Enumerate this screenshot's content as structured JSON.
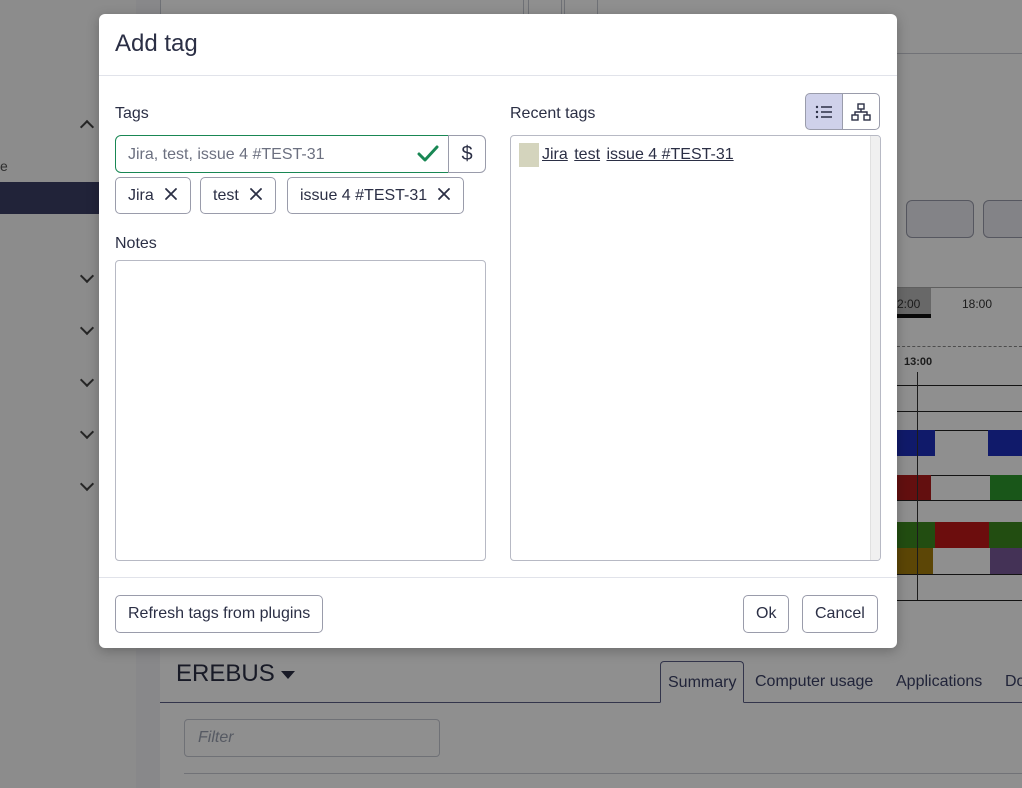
{
  "dialog": {
    "title": "Add tag",
    "tags_label": "Tags",
    "tags_input_value": "Jira, test, issue 4 #TEST-31",
    "billable_symbol": "$",
    "chips": [
      {
        "label": "Jira"
      },
      {
        "label": "test"
      },
      {
        "label": "issue 4 #TEST-31"
      }
    ],
    "notes_label": "Notes",
    "notes_value": "",
    "recent_label": "Recent tags",
    "recent_tags": [
      "Jira",
      "test",
      "issue 4 #TEST-31"
    ],
    "footer": {
      "refresh_label": "Refresh tags from plugins",
      "ok_label": "Ok",
      "cancel_label": "Cancel"
    }
  },
  "background": {
    "sidebar_partial_text": "e",
    "timeline_labels": [
      "2:00",
      "18:00",
      "13:00"
    ],
    "computer_name": "EREBUS",
    "tabs": [
      "Summary",
      "Computer usage",
      "Applications",
      "Do"
    ],
    "filter_placeholder": "Filter"
  },
  "colors": {
    "accent": "#3b3f66",
    "success": "#198754",
    "tag_swatch": "#d4d4bd",
    "active_toggle": "#cfd1ea"
  }
}
